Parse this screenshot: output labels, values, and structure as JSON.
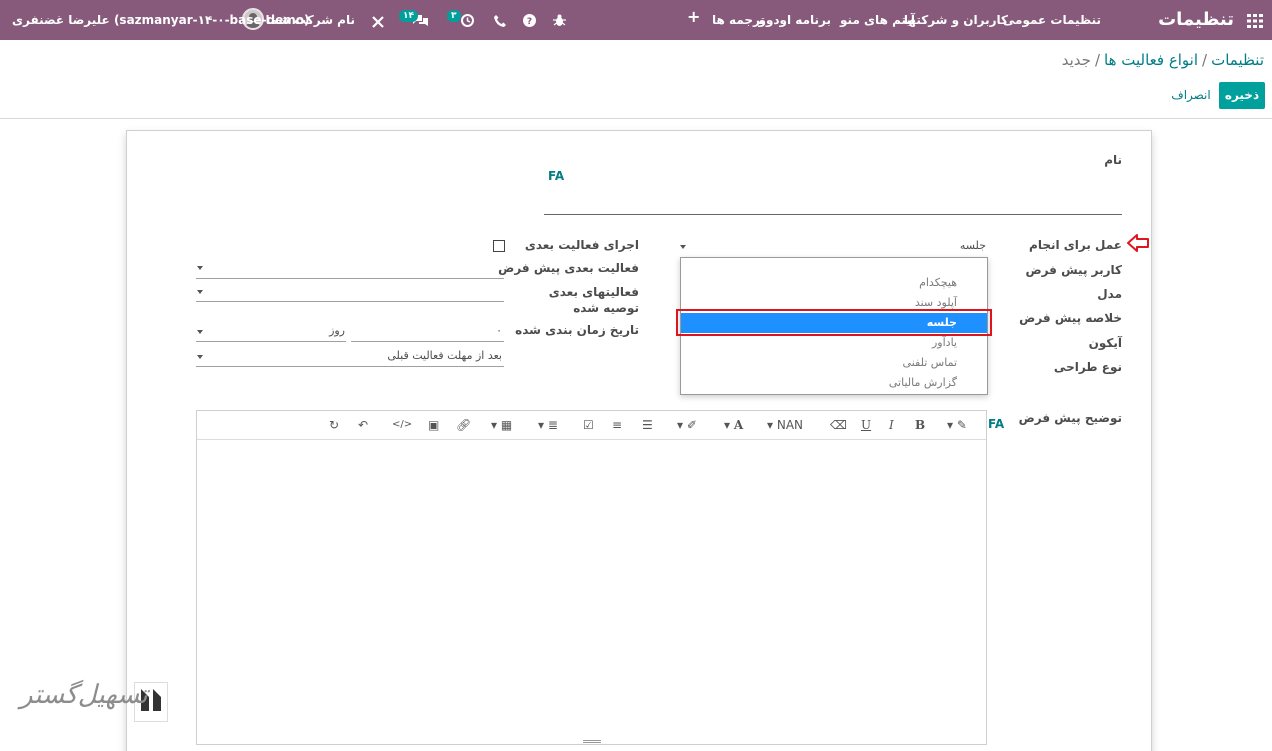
{
  "navbar": {
    "app_title": "تنظیمات",
    "menu": [
      "تنظیمات عمومی",
      "کاربران و شرکتها",
      "آیتم های منو",
      "برنامه اودوو",
      "ترجمه ها"
    ],
    "activity_count": "۳",
    "message_count": "۱۴",
    "company": "نام شرکت شما",
    "user": "علیرضا غضنفری (sazmanyar-۱۴-۰-base-demo)"
  },
  "breadcrumb": {
    "settings": "تنظیمات",
    "sep": "/",
    "types": "انواع فعالیت ها",
    "current": "جدید"
  },
  "buttons": {
    "save": "ذخیره",
    "discard": "انصراف"
  },
  "form": {
    "name_label": "نام",
    "lang_badge": "FA",
    "action_label": "عمل برای انجام",
    "action_value": "جلسه",
    "default_user_label": "کاربر پیش فرض",
    "model_label": "مدل",
    "summary_label": "خلاصه پیش فرض",
    "icon_label": "آیکون",
    "decoration_label": "نوع طراحی",
    "description_label": "توضیح پیش فرض",
    "trigger_next_label": "اجرای فعالیت بعدی",
    "default_next_label": "فعالیت بعدی پیش فرض",
    "recommended_label": "فعالیتهای بعدی توصیه شده",
    "schedule_label": "تاریخ زمان بندی شده",
    "delay_count": "۰",
    "delay_unit": "روز",
    "delay_from": "بعد از مهلت فعالیت قبلی"
  },
  "dropdown": {
    "options": [
      "هیچکدام",
      "آپلود سند",
      "جلسه",
      "یادآور",
      "تماس تلفنی",
      "گزارش مالیاتی"
    ],
    "selected_index": 2
  },
  "editor": {
    "font_size": "NAN"
  },
  "watermark": "تسهیل‌گستر"
}
